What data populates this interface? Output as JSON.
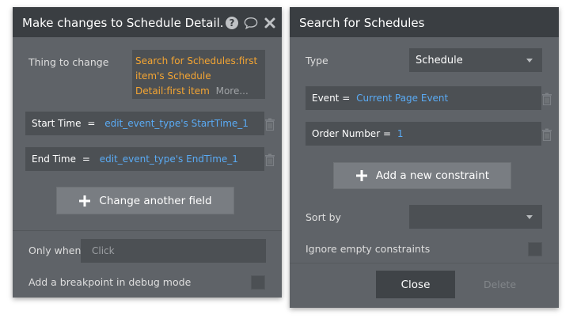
{
  "left_panel": {
    "title": "Make changes to Schedule Detail.",
    "icons": [
      "help-icon",
      "comment-icon",
      "close-icon"
    ],
    "thing_label": "Thing to change",
    "thing_value": "Search for Schedules:first item's Schedule Detail:first item",
    "thing_more": "More...",
    "fields": [
      {
        "label": "Start Time",
        "operator": "=",
        "value": "edit_event_type's StartTime_1"
      },
      {
        "label": "End Time",
        "operator": "=",
        "value": "edit_event_type's EndTime_1"
      }
    ],
    "change_another_label": "Change another field",
    "only_when_label": "Only when",
    "only_when_placeholder": "Click",
    "breakpoint_label": "Add a breakpoint in debug mode"
  },
  "right_panel": {
    "title": "Search for Schedules",
    "type_label": "Type",
    "type_value": "Schedule",
    "constraints": [
      {
        "label": "Event",
        "operator": "=",
        "value": "Current Page Event"
      },
      {
        "label": "Order Number",
        "operator": "=",
        "value": "1"
      }
    ],
    "add_constraint_label": "Add a new constraint",
    "sort_by_label": "Sort by",
    "sort_by_value": "",
    "ignore_empty_label": "Ignore empty constraints",
    "close_label": "Close",
    "delete_label": "Delete"
  },
  "colors": {
    "panel": "#5f6368",
    "header": "#3a3e42",
    "field": "#4c5054",
    "orange_expression": "#f4a533",
    "blue_expression": "#5aabf5"
  }
}
